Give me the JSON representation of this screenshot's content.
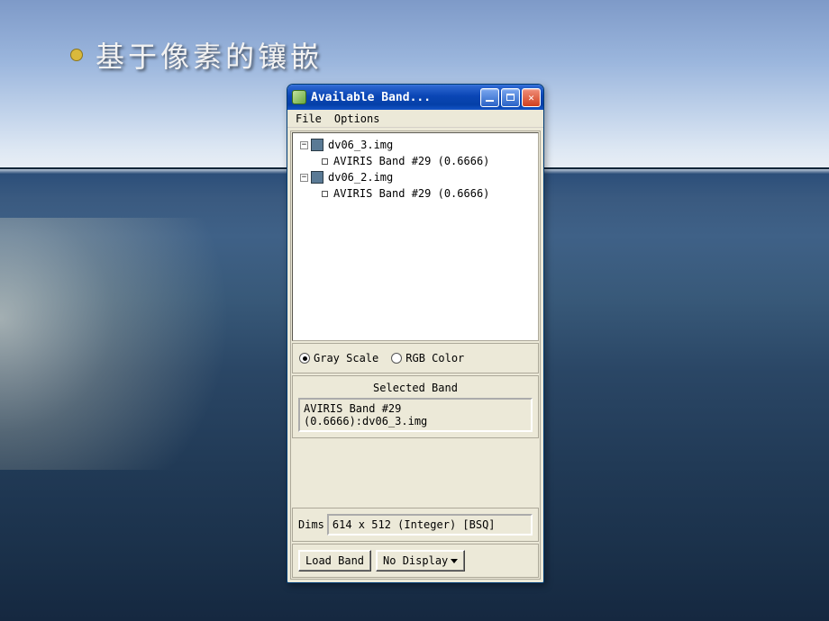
{
  "slide": {
    "bullet_text": "基于像素的镶嵌"
  },
  "window": {
    "title": "Available Band...",
    "menu": {
      "file": "File",
      "options": "Options"
    },
    "tree": {
      "file1": {
        "name": "dv06_3.img",
        "band": "AVIRIS Band #29 (0.6666)"
      },
      "file2": {
        "name": "dv06_2.img",
        "band": "AVIRIS Band #29 (0.6666)"
      }
    },
    "display_mode": {
      "gray": "Gray Scale",
      "rgb": "RGB Color"
    },
    "selected_band": {
      "title": "Selected Band",
      "value": "AVIRIS Band #29 (0.6666):dv06_3.img"
    },
    "dims": {
      "label": "Dims",
      "value": "614 x 512 (Integer) [BSQ]"
    },
    "buttons": {
      "load": "Load Band",
      "display": "No Display"
    }
  }
}
